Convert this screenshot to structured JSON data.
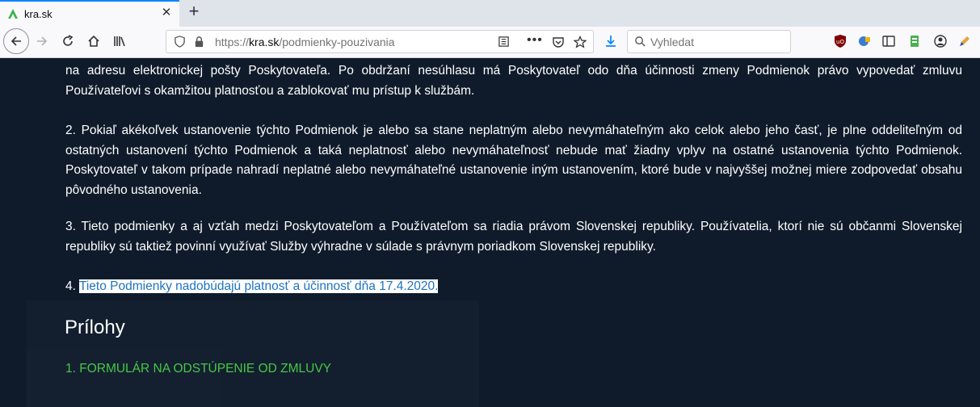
{
  "browser": {
    "tab_title": "kra.sk",
    "url_prefix": "https://",
    "url_host": "kra.sk",
    "url_path": "/podmienky-pouzivania",
    "search_placeholder": "Vyhledat"
  },
  "page": {
    "para_top": "na adresu elektronickej pošty Poskytovateľa. Po obdržaní nesúhlasu má Poskytovateľ odo dňa účinnosti zmeny Podmienok právo vypovedať zmluvu Používateľovi s okamžitou platnosťou a zablokovať mu prístup k službám.",
    "para_2": "2. Pokiaľ akékoľvek ustanovenie týchto Podmienok je alebo sa stane neplatným alebo nevymáhateľným ako celok alebo jeho časť, je plne oddeliteľným od ostatných ustanovení týchto Podmienok a taká neplatnosť alebo nevymáhateľnosť nebude mať žiadny vplyv na ostatné ustanovenia týchto Podmienok. Poskytovateľ v takom prípade nahradí neplatné alebo nevymáhateľné ustanovenie iným ustanovením, ktoré bude v najvyššej možnej miere zodpovedať obsahu pôvodného ustanovenia.",
    "para_3": "3. Tieto podmienky a aj vzťah medzi Poskytovateľom a Používateľom sa riadia právom Slovenskej republiky. Používatelia, ktorí nie sú občanmi Slovenskej republiky sú taktiež povinní využívať Služby výhradne v súlade s právnym poriadkom Slovenskej republiky.",
    "para_4_num": "4.",
    "para_4_text": "Tieto Podmienky nadobúdajú platnosť a účinnosť dňa 17.4.2020.",
    "heading_prilohy": "Prílohy",
    "attachment_1": "1. FORMULÁR NA ODSTÚPENIE OD ZMLUVY"
  },
  "colors": {
    "background": "#0f1b2a",
    "link": "#1e73be",
    "attachment": "#47c747",
    "brand": "#3bb54a"
  }
}
